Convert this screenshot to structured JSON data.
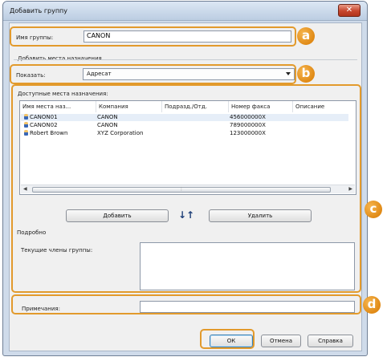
{
  "window": {
    "title": "Добавить группу",
    "close_glyph": "✕"
  },
  "group": {
    "name_label": "Имя группы:",
    "name_value": "CANON"
  },
  "destinations": {
    "section_label": "Добавить места назначения",
    "show_label": "Показать:",
    "show_value": "Адресат",
    "available_label": "Доступные места назначения:",
    "columns": [
      "Имя места наз...",
      "Компания",
      "Подразд./Отд.",
      "Номер факса",
      "Описание"
    ],
    "rows": [
      {
        "name": "CANON01",
        "company": "CANON",
        "dept": "",
        "fax": "456000000X",
        "desc": ""
      },
      {
        "name": "CANON02",
        "company": "CANON",
        "dept": "",
        "fax": "789000000X",
        "desc": ""
      },
      {
        "name": "Robert Brown",
        "company": "XYZ Corporation",
        "dept": "",
        "fax": "123000000X",
        "desc": ""
      }
    ],
    "add_button": "Добавить",
    "move_arrows": "↓↑",
    "remove_button": "Удалить",
    "details_label": "Подробно",
    "members_label": "Текущие члены группы:"
  },
  "notes": {
    "label": "Примечания:",
    "value": ""
  },
  "buttons": {
    "ok": "ОК",
    "cancel": "Отмена",
    "help": "Справка"
  },
  "callouts": {
    "a": "a",
    "b": "b",
    "c": "c",
    "d": "d"
  },
  "colors": {
    "callout": "#e29a2c",
    "selected_row": "#e6eef8"
  }
}
